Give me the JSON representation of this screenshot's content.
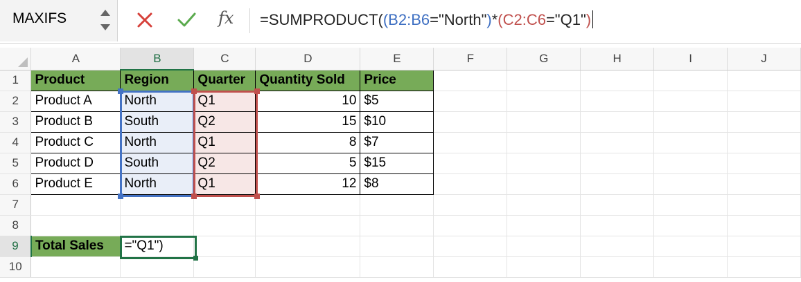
{
  "name_box": {
    "value": "MAXIFS"
  },
  "formula_bar": {
    "cancel_icon": "close-icon",
    "enter_icon": "check-icon",
    "fx_label": "fx",
    "formula_parts": {
      "prefix": "=SUMPRODUCT(",
      "open_b": "(",
      "ref_b": "B2:B6",
      "mid_b": "=\"North\"",
      "close_b": ")",
      "star": "*",
      "open_c": "(",
      "ref_c": "C2:C6",
      "mid_c": "=\"Q1\"",
      "close_c": ")"
    }
  },
  "columns": [
    "A",
    "B",
    "C",
    "D",
    "E",
    "F",
    "G",
    "H",
    "I",
    "J"
  ],
  "rows": [
    "1",
    "2",
    "3",
    "4",
    "5",
    "6",
    "7",
    "8",
    "9",
    "10"
  ],
  "table": {
    "headers": [
      "Product",
      "Region",
      "Quarter",
      "Quantity Sold",
      "Price"
    ],
    "records": [
      {
        "product": "Product A",
        "region": "North",
        "quarter": "Q1",
        "qty": "10",
        "cur": "$",
        "price": "5"
      },
      {
        "product": "Product B",
        "region": "South",
        "quarter": "Q2",
        "qty": "15",
        "cur": "$",
        "price": "10"
      },
      {
        "product": "Product C",
        "region": "North",
        "quarter": "Q1",
        "qty": "8",
        "cur": "$",
        "price": "7"
      },
      {
        "product": "Product D",
        "region": "South",
        "quarter": "Q2",
        "qty": "5",
        "cur": "$",
        "price": "15"
      },
      {
        "product": "Product E",
        "region": "North",
        "quarter": "Q1",
        "qty": "12",
        "cur": "$",
        "price": "8"
      }
    ]
  },
  "total": {
    "label": "Total Sales",
    "edit_value": "=\"Q1\")"
  },
  "colors": {
    "header_fill": "#77ab58",
    "range_b": "#4472c4",
    "range_c": "#c0504d",
    "active": "#217346"
  }
}
